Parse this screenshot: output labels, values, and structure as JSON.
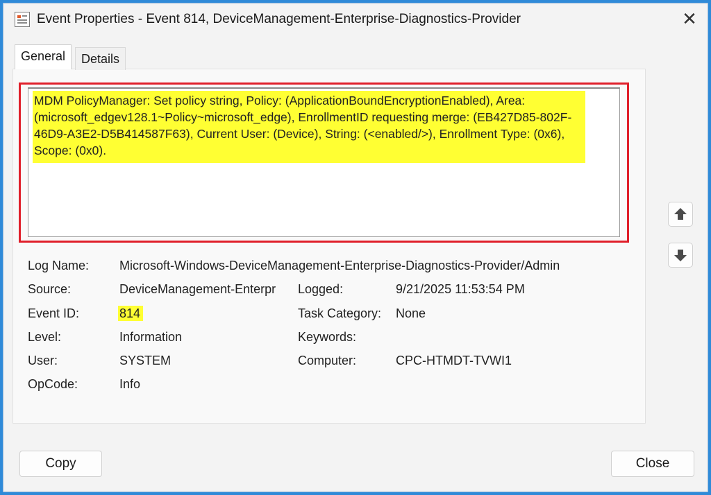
{
  "window": {
    "title": "Event Properties - Event 814, DeviceManagement-Enterprise-Diagnostics-Provider",
    "close_glyph": "✕"
  },
  "tabs": [
    {
      "label": "General",
      "selected": true
    },
    {
      "label": "Details",
      "selected": false
    }
  ],
  "description": {
    "text": "MDM PolicyManager: Set policy string, Policy: (ApplicationBoundEncryptionEnabled), Area: (microsoft_edgev128.1~Policy~microsoft_edge), EnrollmentID requesting merge: (EB427D85-802F-46D9-A3E2-D5B414587F63), Current User: (Device), String: (<enabled/>), Enrollment Type: (0x6), Scope: (0x0)."
  },
  "fields": {
    "log_name": {
      "label": "Log Name:",
      "value": "Microsoft-Windows-DeviceManagement-Enterprise-Diagnostics-Provider/Admin"
    },
    "source": {
      "label": "Source:",
      "value": "DeviceManagement-Enterpr"
    },
    "logged": {
      "label": "Logged:",
      "value": "9/21/2025 11:53:54 PM"
    },
    "event_id": {
      "label": "Event ID:",
      "value": "814"
    },
    "task_category": {
      "label": "Task Category:",
      "value": "None"
    },
    "level": {
      "label": "Level:",
      "value": "Information"
    },
    "keywords": {
      "label": "Keywords:",
      "value": ""
    },
    "user": {
      "label": "User:",
      "value": "SYSTEM"
    },
    "computer": {
      "label": "Computer:",
      "value": "CPC-HTMDT-TVWI1"
    },
    "opcode": {
      "label": "OpCode:",
      "value": "Info"
    }
  },
  "buttons": {
    "copy": "Copy",
    "close": "Close"
  },
  "icons": {
    "app": "event-viewer-icon",
    "up": "arrow-up-icon",
    "down": "arrow-down-icon"
  },
  "colors": {
    "highlight": "#ffff33",
    "outline": "#e01f2a",
    "background": "#2f8ad8"
  }
}
